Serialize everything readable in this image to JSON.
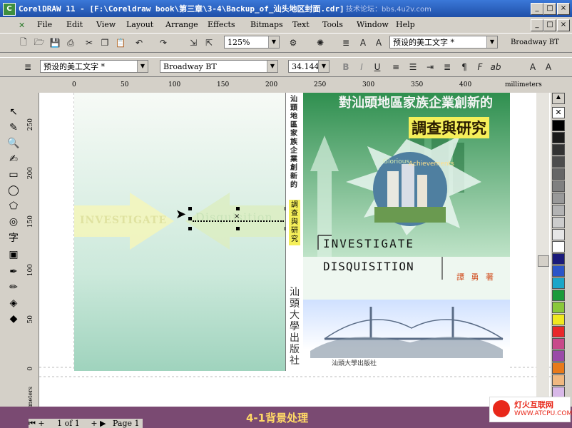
{
  "window": {
    "title": "CorelDRAW 11 - [F:\\Coreldraw book\\第三章\\3-4\\Backup_of_汕头地区封面.cdr]",
    "watermark": "技术论坛：bbs.4u2v.com",
    "app_icon": "coreldraw-icon",
    "minimize": "_",
    "restore": "□",
    "close": "×"
  },
  "menu": {
    "items": [
      "File",
      "Edit",
      "View",
      "Layout",
      "Arrange",
      "Effects",
      "Bitmaps",
      "Text",
      "Tools",
      "Window",
      "Help"
    ],
    "doc_min": "_",
    "doc_restore": "□",
    "doc_close": "×"
  },
  "standard_toolbar": {
    "zoom": "125%",
    "style_font": "预设的美工文字 *",
    "font_name": "Broadway BT"
  },
  "property_bar": {
    "style": "预设的美工文字 *",
    "font": "Broadway BT",
    "font_size": "34.144",
    "bold": "B",
    "italic": "I",
    "underline": "U",
    "frame": "F",
    "ab": "ab"
  },
  "rulers": {
    "unit": "millimeters",
    "h_ticks": [
      "0",
      "50",
      "100",
      "150",
      "200",
      "250",
      "300",
      "350",
      "400"
    ],
    "v_ticks": [
      "250",
      "200",
      "150",
      "100",
      "50",
      "0"
    ],
    "v_unit": "millimeters"
  },
  "cover": {
    "left_word1": "INVESTIGATE",
    "left_word2": "Disquisition",
    "spine_title": "汕頭地區家族企業創新的",
    "spine_sub": "調查與研究",
    "spine_publisher": "汕頭大學出版社",
    "front_title": "對汕頭地區家族企業創新的",
    "front_sub": "調查與研究",
    "badge_text1": "Glorious",
    "badge_text2": "Achievements",
    "front_en1": "INVESTIGATE",
    "front_en2": "DISQUISITION",
    "author": "譚 勇 著",
    "publisher": "汕頭大學出版社"
  },
  "status": {
    "page_counter": "1 of 1",
    "page_tab": "Page 1",
    "caption": "4-1背景处理"
  },
  "logo": {
    "name": "灯火互联网",
    "url": "WWW.ATCPU.COM"
  },
  "colors": {
    "titlebar": "#1f4fa8",
    "caption_bar": "#7a4a72",
    "caption_text": "#ffd966",
    "spine_highlight": "#f5ef5a"
  }
}
